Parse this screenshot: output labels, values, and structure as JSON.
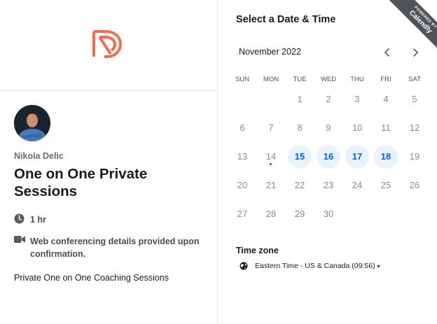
{
  "host": {
    "name": "Nikola Delic",
    "event_title": "One on One Private Sessions",
    "duration": "1 hr",
    "conferencing": "Web conferencing details provided upon confirmation.",
    "description": "Private One on One Coaching Sessions",
    "brand_color": "#f26d4f"
  },
  "picker": {
    "heading": "Select a Date & Time",
    "month_label": "November 2022",
    "weekdays": [
      "SUN",
      "MON",
      "TUE",
      "WED",
      "THU",
      "FRI",
      "SAT"
    ],
    "weeks": [
      [
        "",
        "",
        "1",
        "2",
        "3",
        "4",
        "5"
      ],
      [
        "6",
        "7",
        "8",
        "9",
        "10",
        "11",
        "12"
      ],
      [
        "13",
        "14",
        "15",
        "16",
        "17",
        "18",
        "19"
      ],
      [
        "20",
        "21",
        "22",
        "23",
        "24",
        "25",
        "26"
      ],
      [
        "27",
        "28",
        "29",
        "30",
        "",
        "",
        ""
      ]
    ],
    "available_days": [
      "15",
      "16",
      "17",
      "18"
    ],
    "today": "14",
    "accent_color": "#0060e6",
    "available_bg": "#eaf2fd",
    "prev_icon": "chevron-left-icon",
    "next_icon": "chevron-right-icon"
  },
  "timezone": {
    "label": "Time zone",
    "value": "Eastern Time - US & Canada (09:56)",
    "icon": "globe-icon",
    "caret": "▾"
  },
  "badge": {
    "line1": "POWERED BY",
    "line2": "Calendly"
  }
}
